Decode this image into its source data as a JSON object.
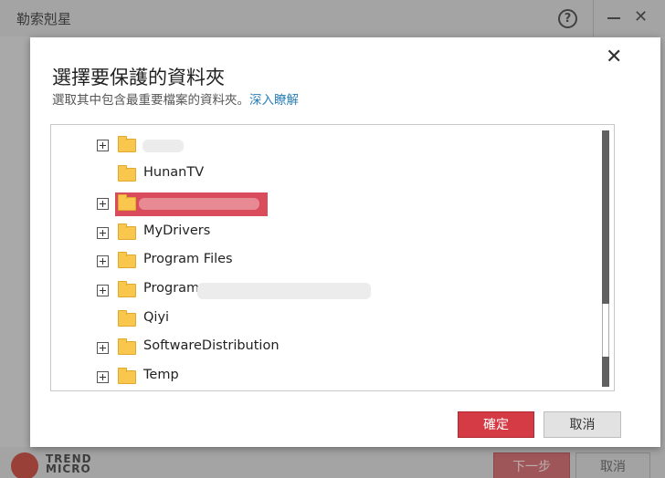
{
  "app": {
    "title": "勒索剋星",
    "help_glyph": "?",
    "close_glyph": "✕",
    "logo_line1": "TREND",
    "logo_line2": "MICRO",
    "next_label": "下一步",
    "cancel_label": "取消"
  },
  "dialog": {
    "title": "選擇要保護的資料夾",
    "subtitle": "選取其中包含最重要檔案的資料夾。",
    "learn_more": "深入瞭解",
    "close_glyph": "✕",
    "ok_label": "確定",
    "cancel_label": "取消"
  },
  "tree": {
    "items": [
      {
        "label": "",
        "expandable": true,
        "selected": false,
        "redacted": true
      },
      {
        "label": "HunanTV",
        "expandable": false,
        "selected": false,
        "redacted": false
      },
      {
        "label": "",
        "expandable": true,
        "selected": true,
        "redacted": true
      },
      {
        "label": "MyDrivers",
        "expandable": true,
        "selected": false,
        "redacted": false
      },
      {
        "label": "Program Files",
        "expandable": true,
        "selected": false,
        "redacted": false
      },
      {
        "label": "Program",
        "expandable": true,
        "selected": false,
        "redacted": true
      },
      {
        "label": "Qiyi",
        "expandable": false,
        "selected": false,
        "redacted": false
      },
      {
        "label": "SoftwareDistribution",
        "expandable": true,
        "selected": false,
        "redacted": false
      },
      {
        "label": "Temp",
        "expandable": true,
        "selected": false,
        "redacted": false
      }
    ]
  },
  "colors": {
    "primary_red": "#d43b45",
    "folder_yellow": "#f9c64e",
    "link_blue": "#2a7fb8",
    "selection_red": "#d94c5b"
  }
}
